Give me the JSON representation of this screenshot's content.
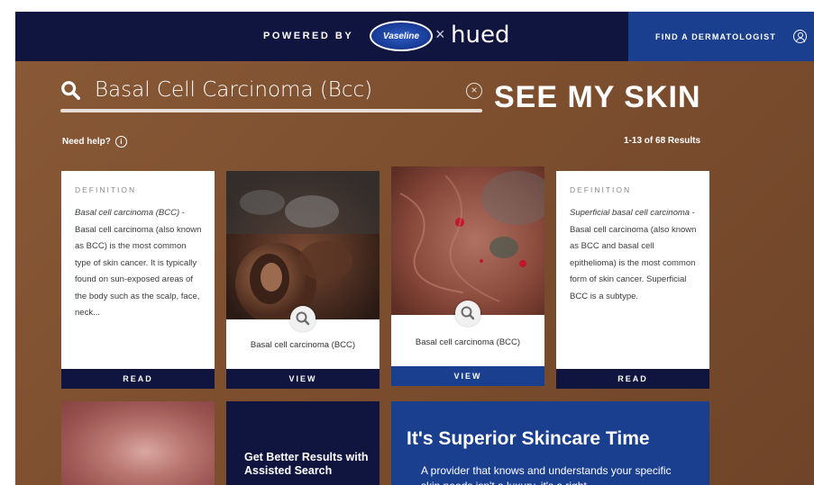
{
  "header": {
    "powered_by": "POWERED BY",
    "brand_vaseline": "Vaseline",
    "separator": "×",
    "brand_hued": "hued",
    "find_dermatologist": "FIND A DERMATOLOGIST"
  },
  "search": {
    "query": "Basal Cell Carcinoma (Bcc)",
    "title": "SEE MY SKIN"
  },
  "help": {
    "need_help": "Need help?",
    "info_glyph": "i",
    "results": "1-13 of 68 Results"
  },
  "cards": [
    {
      "type": "definition",
      "label": "DEFINITION",
      "term": "Basal cell carcinoma (BCC)",
      "text": " - Basal cell carcinoma (also known as BCC) is the most common type of skin cancer. It is typically found on sun-exposed areas of the body such as the scalp, face, neck...",
      "button": "READ"
    },
    {
      "type": "image",
      "caption": "Basal cell carcinoma (BCC)",
      "button": "VIEW"
    },
    {
      "type": "image",
      "caption": "Basal cell carcinoma (BCC)",
      "button": "VIEW"
    },
    {
      "type": "definition",
      "label": "DEFINITION",
      "term": "Superficial basal cell carcinoma",
      "text": " - Basal cell carcinoma (also known as BCC and basal cell epithelioma) is the most common form of skin cancer. Superficial BCC is a subtype.",
      "button": "READ"
    }
  ],
  "bottom": {
    "assist_title": "Get Better Results with Assisted Search",
    "superior_title": "It's Superior Skincare Time",
    "superior_text": "A provider that knows and understands your specific skin needs isn't a luxury, it's a right."
  },
  "icons": {
    "search": "search-icon",
    "clear": "close-circle-icon",
    "info": "info-icon",
    "user": "user-circle-icon",
    "zoom": "zoom-icon"
  },
  "colors": {
    "navy": "#10153f",
    "blue": "#1a3f8f",
    "brown_bg": "#7d4f2f",
    "white": "#ffffff"
  }
}
